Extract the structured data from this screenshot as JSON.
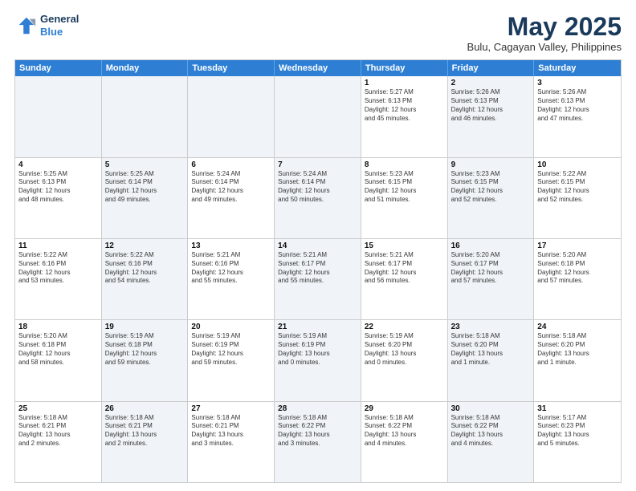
{
  "logo": {
    "line1": "General",
    "line2": "Blue"
  },
  "title": "May 2025",
  "subtitle": "Bulu, Cagayan Valley, Philippines",
  "header_days": [
    "Sunday",
    "Monday",
    "Tuesday",
    "Wednesday",
    "Thursday",
    "Friday",
    "Saturday"
  ],
  "weeks": [
    [
      {
        "day": "",
        "info": "",
        "shaded": true
      },
      {
        "day": "",
        "info": "",
        "shaded": true
      },
      {
        "day": "",
        "info": "",
        "shaded": true
      },
      {
        "day": "",
        "info": "",
        "shaded": true
      },
      {
        "day": "1",
        "info": "Sunrise: 5:27 AM\nSunset: 6:13 PM\nDaylight: 12 hours\nand 45 minutes.",
        "shaded": false
      },
      {
        "day": "2",
        "info": "Sunrise: 5:26 AM\nSunset: 6:13 PM\nDaylight: 12 hours\nand 46 minutes.",
        "shaded": true
      },
      {
        "day": "3",
        "info": "Sunrise: 5:26 AM\nSunset: 6:13 PM\nDaylight: 12 hours\nand 47 minutes.",
        "shaded": false
      }
    ],
    [
      {
        "day": "4",
        "info": "Sunrise: 5:25 AM\nSunset: 6:13 PM\nDaylight: 12 hours\nand 48 minutes.",
        "shaded": false
      },
      {
        "day": "5",
        "info": "Sunrise: 5:25 AM\nSunset: 6:14 PM\nDaylight: 12 hours\nand 49 minutes.",
        "shaded": true
      },
      {
        "day": "6",
        "info": "Sunrise: 5:24 AM\nSunset: 6:14 PM\nDaylight: 12 hours\nand 49 minutes.",
        "shaded": false
      },
      {
        "day": "7",
        "info": "Sunrise: 5:24 AM\nSunset: 6:14 PM\nDaylight: 12 hours\nand 50 minutes.",
        "shaded": true
      },
      {
        "day": "8",
        "info": "Sunrise: 5:23 AM\nSunset: 6:15 PM\nDaylight: 12 hours\nand 51 minutes.",
        "shaded": false
      },
      {
        "day": "9",
        "info": "Sunrise: 5:23 AM\nSunset: 6:15 PM\nDaylight: 12 hours\nand 52 minutes.",
        "shaded": true
      },
      {
        "day": "10",
        "info": "Sunrise: 5:22 AM\nSunset: 6:15 PM\nDaylight: 12 hours\nand 52 minutes.",
        "shaded": false
      }
    ],
    [
      {
        "day": "11",
        "info": "Sunrise: 5:22 AM\nSunset: 6:16 PM\nDaylight: 12 hours\nand 53 minutes.",
        "shaded": false
      },
      {
        "day": "12",
        "info": "Sunrise: 5:22 AM\nSunset: 6:16 PM\nDaylight: 12 hours\nand 54 minutes.",
        "shaded": true
      },
      {
        "day": "13",
        "info": "Sunrise: 5:21 AM\nSunset: 6:16 PM\nDaylight: 12 hours\nand 55 minutes.",
        "shaded": false
      },
      {
        "day": "14",
        "info": "Sunrise: 5:21 AM\nSunset: 6:17 PM\nDaylight: 12 hours\nand 55 minutes.",
        "shaded": true
      },
      {
        "day": "15",
        "info": "Sunrise: 5:21 AM\nSunset: 6:17 PM\nDaylight: 12 hours\nand 56 minutes.",
        "shaded": false
      },
      {
        "day": "16",
        "info": "Sunrise: 5:20 AM\nSunset: 6:17 PM\nDaylight: 12 hours\nand 57 minutes.",
        "shaded": true
      },
      {
        "day": "17",
        "info": "Sunrise: 5:20 AM\nSunset: 6:18 PM\nDaylight: 12 hours\nand 57 minutes.",
        "shaded": false
      }
    ],
    [
      {
        "day": "18",
        "info": "Sunrise: 5:20 AM\nSunset: 6:18 PM\nDaylight: 12 hours\nand 58 minutes.",
        "shaded": false
      },
      {
        "day": "19",
        "info": "Sunrise: 5:19 AM\nSunset: 6:18 PM\nDaylight: 12 hours\nand 59 minutes.",
        "shaded": true
      },
      {
        "day": "20",
        "info": "Sunrise: 5:19 AM\nSunset: 6:19 PM\nDaylight: 12 hours\nand 59 minutes.",
        "shaded": false
      },
      {
        "day": "21",
        "info": "Sunrise: 5:19 AM\nSunset: 6:19 PM\nDaylight: 13 hours\nand 0 minutes.",
        "shaded": true
      },
      {
        "day": "22",
        "info": "Sunrise: 5:19 AM\nSunset: 6:20 PM\nDaylight: 13 hours\nand 0 minutes.",
        "shaded": false
      },
      {
        "day": "23",
        "info": "Sunrise: 5:18 AM\nSunset: 6:20 PM\nDaylight: 13 hours\nand 1 minute.",
        "shaded": true
      },
      {
        "day": "24",
        "info": "Sunrise: 5:18 AM\nSunset: 6:20 PM\nDaylight: 13 hours\nand 1 minute.",
        "shaded": false
      }
    ],
    [
      {
        "day": "25",
        "info": "Sunrise: 5:18 AM\nSunset: 6:21 PM\nDaylight: 13 hours\nand 2 minutes.",
        "shaded": false
      },
      {
        "day": "26",
        "info": "Sunrise: 5:18 AM\nSunset: 6:21 PM\nDaylight: 13 hours\nand 2 minutes.",
        "shaded": true
      },
      {
        "day": "27",
        "info": "Sunrise: 5:18 AM\nSunset: 6:21 PM\nDaylight: 13 hours\nand 3 minutes.",
        "shaded": false
      },
      {
        "day": "28",
        "info": "Sunrise: 5:18 AM\nSunset: 6:22 PM\nDaylight: 13 hours\nand 3 minutes.",
        "shaded": true
      },
      {
        "day": "29",
        "info": "Sunrise: 5:18 AM\nSunset: 6:22 PM\nDaylight: 13 hours\nand 4 minutes.",
        "shaded": false
      },
      {
        "day": "30",
        "info": "Sunrise: 5:18 AM\nSunset: 6:22 PM\nDaylight: 13 hours\nand 4 minutes.",
        "shaded": true
      },
      {
        "day": "31",
        "info": "Sunrise: 5:17 AM\nSunset: 6:23 PM\nDaylight: 13 hours\nand 5 minutes.",
        "shaded": false
      }
    ]
  ]
}
